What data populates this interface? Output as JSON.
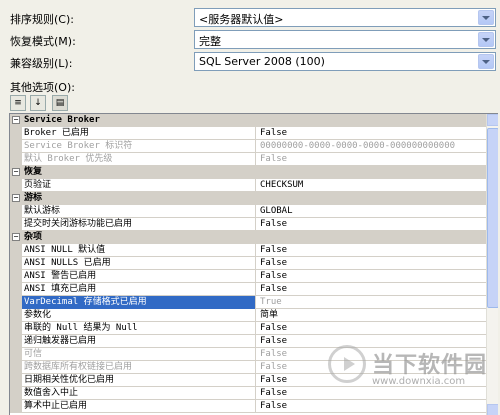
{
  "fields": [
    {
      "label": "排序规则(C):",
      "value": "<服务器默认值>"
    },
    {
      "label": "恢复模式(M):",
      "value": "完整"
    },
    {
      "label": "兼容级别(L):",
      "value": "SQL Server 2008 (100)"
    }
  ],
  "other_options_label": "其他选项(O):",
  "grid": {
    "categories": [
      {
        "name": "Service Broker",
        "rows": [
          {
            "name": "Broker 已启用",
            "value": "False",
            "disabled": false
          },
          {
            "name": "Service Broker 标识符",
            "value": "00000000-0000-0000-0000-000000000000",
            "disabled": true
          },
          {
            "name": "默认 Broker 优先级",
            "value": "False",
            "disabled": true
          }
        ]
      },
      {
        "name": "恢复",
        "rows": [
          {
            "name": "页验证",
            "value": "CHECKSUM",
            "disabled": false
          }
        ]
      },
      {
        "name": "游标",
        "rows": [
          {
            "name": "默认游标",
            "value": "GLOBAL",
            "disabled": false
          },
          {
            "name": "提交时关闭游标功能已启用",
            "value": "False",
            "disabled": false
          }
        ]
      },
      {
        "name": "杂项",
        "rows": [
          {
            "name": "ANSI NULL 默认值",
            "value": "False",
            "disabled": false
          },
          {
            "name": "ANSI NULLS 已启用",
            "value": "False",
            "disabled": false
          },
          {
            "name": "ANSI 警告已启用",
            "value": "False",
            "disabled": false
          },
          {
            "name": "ANSI 填充已启用",
            "value": "False",
            "disabled": false
          },
          {
            "name": "VarDecimal 存储格式已启用",
            "value": "True",
            "disabled": true,
            "selected": true
          },
          {
            "name": "参数化",
            "value": "简单",
            "disabled": false
          },
          {
            "name": "串联的 Null 结果为 Null",
            "value": "False",
            "disabled": false
          },
          {
            "name": "递归触发器已启用",
            "value": "False",
            "disabled": false
          },
          {
            "name": "可信",
            "value": "False",
            "disabled": true
          },
          {
            "name": "跨数据库所有权链接已启用",
            "value": "False",
            "disabled": true
          },
          {
            "name": "日期相关性优化已启用",
            "value": "False",
            "disabled": false
          },
          {
            "name": "数值舍入中止",
            "value": "False",
            "disabled": false
          },
          {
            "name": "算术中止已启用",
            "value": "False",
            "disabled": false
          }
        ]
      }
    ]
  },
  "watermark": {
    "title": "当下软件园",
    "url": "www.downxia.com"
  },
  "colors": {
    "selection": "#316ac5",
    "disabled_text": "#a0a0a0",
    "category_bg": "#d4d0c8"
  },
  "icons": [
    "categorized-icon",
    "alphabetical-icon",
    "property-pages-icon",
    "dropdown-arrow-icon"
  ]
}
